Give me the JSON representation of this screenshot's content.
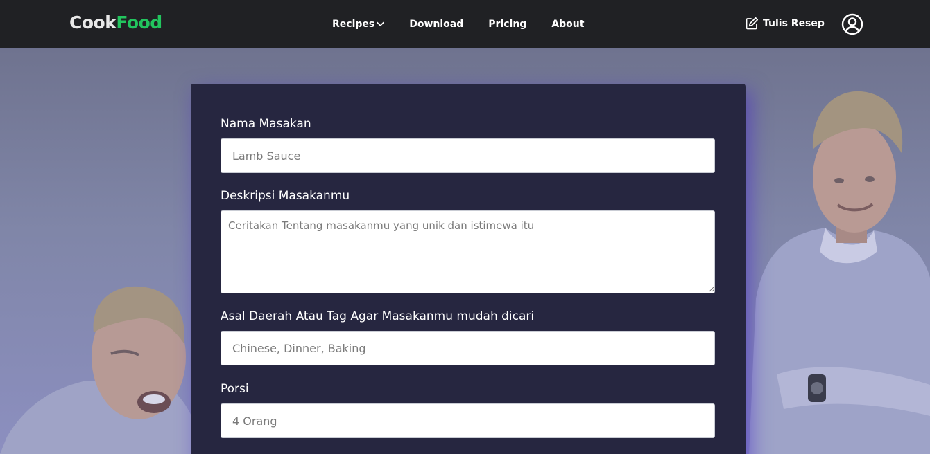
{
  "brand": {
    "part1": "Cook",
    "part2": "Food"
  },
  "nav": {
    "items": [
      {
        "label": "Recipes",
        "has_dropdown": true
      },
      {
        "label": "Download"
      },
      {
        "label": "Pricing"
      },
      {
        "label": "About"
      }
    ],
    "write_recipe_label": "Tulis Resep",
    "write_recipe_icon": "edit-icon",
    "account_icon": "user-circle-icon"
  },
  "form": {
    "dish_name": {
      "label": "Nama Masakan",
      "placeholder": "Lamb Sauce"
    },
    "description": {
      "label": "Deskripsi Masakanmu",
      "placeholder": "Ceritakan Tentang masakanmu yang unik dan istimewa itu"
    },
    "tags": {
      "label": "Asal Daerah Atau Tag Agar Masakanmu mudah dicari",
      "placeholder": "Chinese, Dinner, Baking"
    },
    "portions": {
      "label": "Porsi",
      "placeholder": "4 Orang"
    }
  },
  "colors": {
    "navbar_bg": "#202124",
    "brand_accent": "#22c55e",
    "card_bg": "#262640",
    "hero_bg": "#7c80a4"
  }
}
